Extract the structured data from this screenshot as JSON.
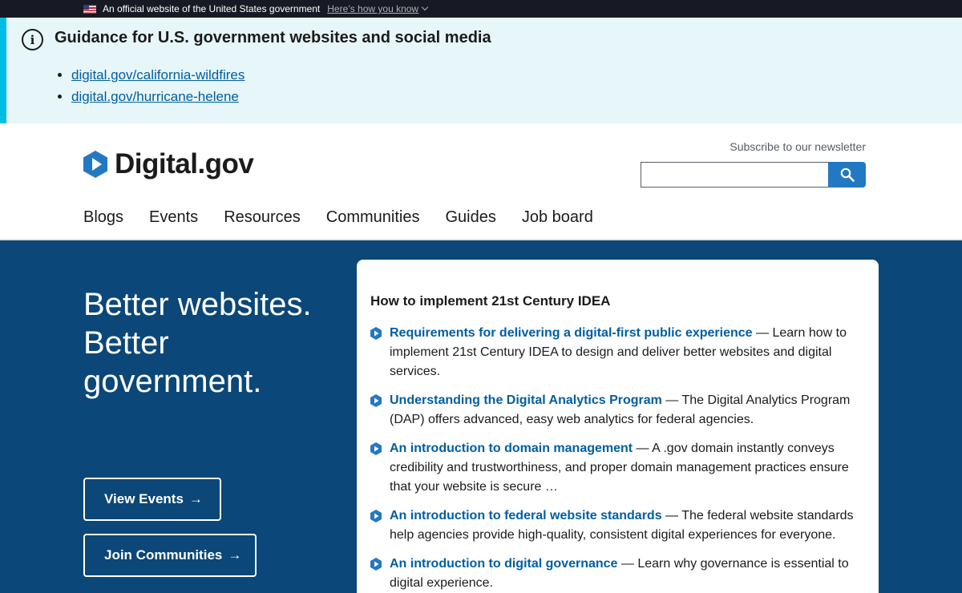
{
  "gov_banner": {
    "official_text": "An official website of the United States government",
    "how_you_know": "Here’s how you know"
  },
  "alert": {
    "title": "Guidance for U.S. government websites and social media",
    "links": [
      "digital.gov/california-wildfires",
      "digital.gov/hurricane-helene"
    ]
  },
  "header": {
    "logo_text": "Digital.gov",
    "newsletter_label": "Subscribe to our newsletter",
    "search_value": ""
  },
  "nav": [
    "Blogs",
    "Events",
    "Resources",
    "Communities",
    "Guides",
    "Job board"
  ],
  "hero": {
    "title": "Better websites. Better government.",
    "buttons": [
      "View Events",
      "Join Communities"
    ],
    "arrow": "→"
  },
  "card": {
    "title": "How to implement 21st Century IDEA",
    "items": [
      {
        "link": "Requirements for delivering a digital-first public experience",
        "desc": " — Learn how to implement 21st Century IDEA to design and deliver better websites and digital services."
      },
      {
        "link": "Understanding the Digital Analytics Program",
        "desc": " — The Digital Analytics Program (DAP) offers advanced, easy web analytics for federal agencies."
      },
      {
        "link": "An introduction to domain management",
        "desc": " — A .gov domain instantly conveys credibility and trustworthiness, and proper domain management practices ensure that your website is secure …"
      },
      {
        "link": "An introduction to federal website standards",
        "desc": " — The federal website standards help agencies provide high-quality, consistent digital experiences for everyone."
      },
      {
        "link": "An introduction to digital governance",
        "desc": " — Learn why governance is essential to digital experience."
      }
    ]
  },
  "colors": {
    "banner_bg": "#171a24",
    "alert_bg": "#e7f6f8",
    "alert_border": "#00bde3",
    "hero_bg": "#0b4778",
    "link": "#005ea2",
    "search_button": "#2378c3"
  }
}
